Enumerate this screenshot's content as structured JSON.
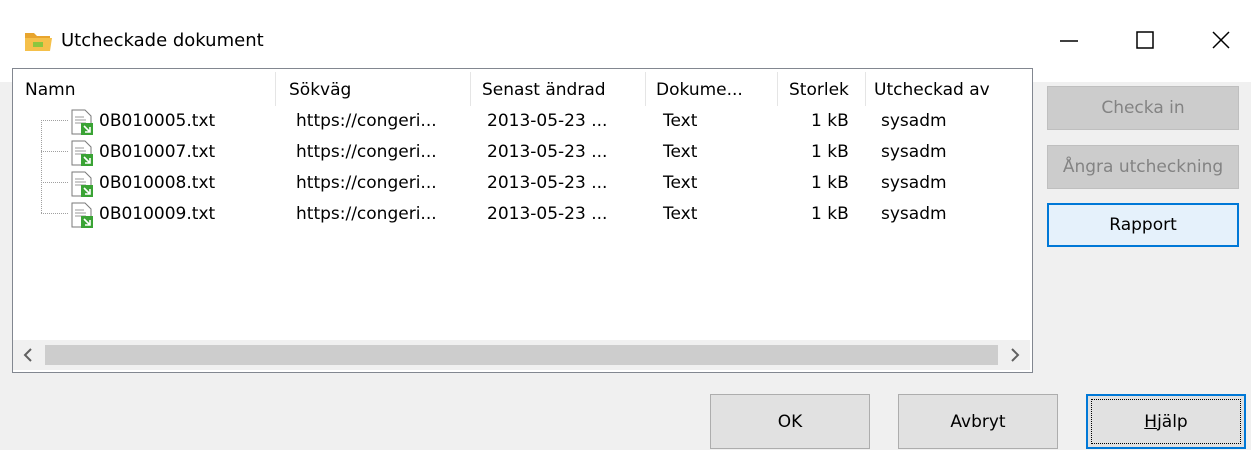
{
  "window": {
    "title": "Utcheckade dokument",
    "controls": {
      "minimize": "minimize-icon",
      "maximize": "maximize-icon",
      "close": "close-icon"
    }
  },
  "list": {
    "columns": [
      "Namn",
      "Sökväg",
      "Senast ändrad",
      "Dokume...",
      "Storlek",
      "Utcheckad av"
    ],
    "rows": [
      {
        "name": "0B010005.txt",
        "path": "https://congeri...",
        "modified": "2013-05-23 ...",
        "type": "Text",
        "size": "1 kB",
        "checked_out_by": "sysadm"
      },
      {
        "name": "0B010007.txt",
        "path": "https://congeri...",
        "modified": "2013-05-23 ...",
        "type": "Text",
        "size": "1 kB",
        "checked_out_by": "sysadm"
      },
      {
        "name": "0B010008.txt",
        "path": "https://congeri...",
        "modified": "2013-05-23 ...",
        "type": "Text",
        "size": "1 kB",
        "checked_out_by": "sysadm"
      },
      {
        "name": "0B010009.txt",
        "path": "https://congeri...",
        "modified": "2013-05-23 ...",
        "type": "Text",
        "size": "1 kB",
        "checked_out_by": "sysadm"
      }
    ]
  },
  "side_buttons": {
    "check_in": "Checka in",
    "undo_checkout": "Ångra utcheckning",
    "report": "Rapport"
  },
  "footer_buttons": {
    "ok": "OK",
    "cancel": "Avbryt",
    "help_mnemonic": "H",
    "help_rest": "jälp"
  },
  "colors": {
    "accent": "#0078d7",
    "folder_icon": "#f2b33d",
    "doc_icon_green": "#3aa335"
  }
}
